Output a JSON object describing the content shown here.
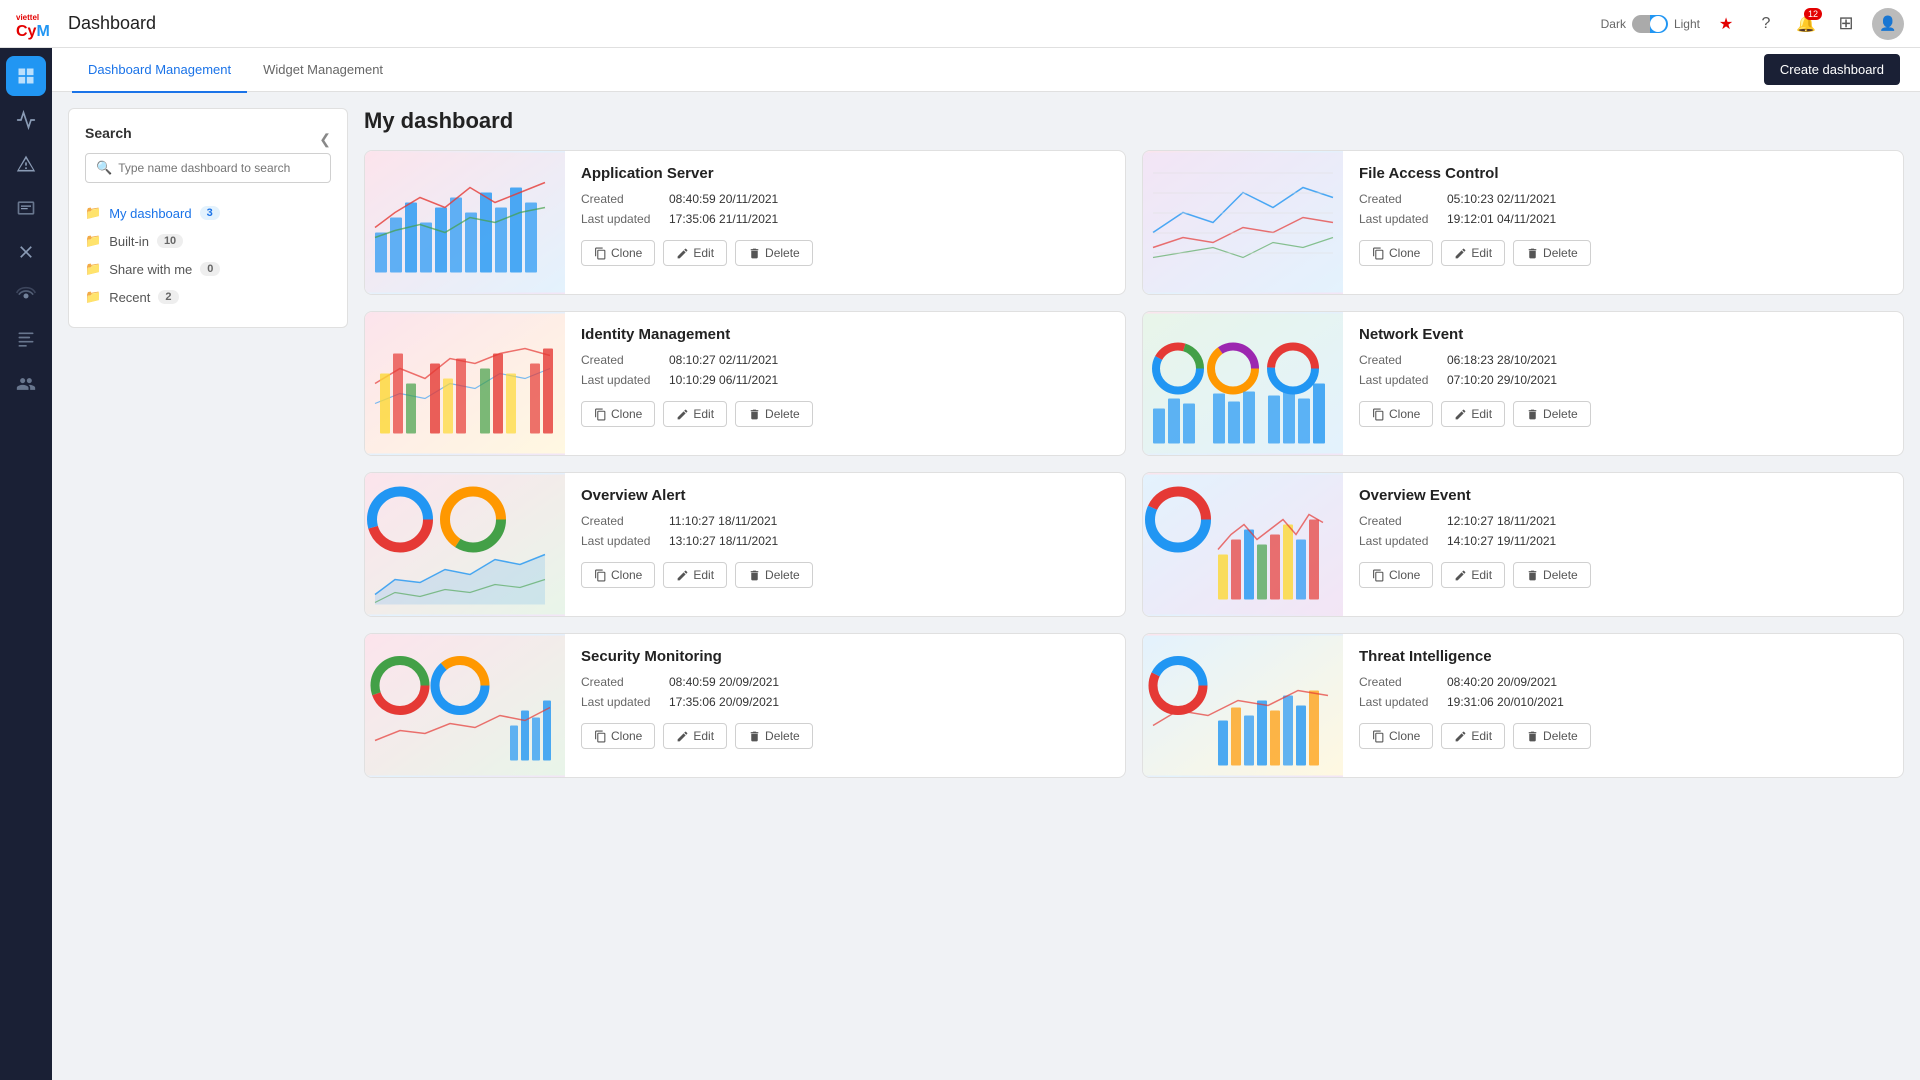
{
  "app": {
    "logo_brand": "viettel",
    "logo_product": "CyM",
    "title": "Dashboard"
  },
  "topnav": {
    "theme_dark": "Dark",
    "theme_light": "Light",
    "notification_count": "12",
    "create_btn": "Create dashboard"
  },
  "tabs": [
    {
      "id": "dashboard-management",
      "label": "Dashboard Management",
      "active": true
    },
    {
      "id": "widget-management",
      "label": "Widget Management",
      "active": false
    }
  ],
  "search": {
    "title": "Search",
    "placeholder": "Type name dashboard to search"
  },
  "nav_items": [
    {
      "id": "my-dashboard",
      "label": "My dashboard",
      "badge": "3",
      "badge_type": "blue",
      "active": true
    },
    {
      "id": "built-in",
      "label": "Built-in",
      "badge": "10",
      "badge_type": "gray",
      "active": false
    },
    {
      "id": "share-with-me",
      "label": "Share with me",
      "badge": "0",
      "badge_type": "gray",
      "active": false
    },
    {
      "id": "recent",
      "label": "Recent",
      "badge": "2",
      "badge_type": "gray",
      "active": false
    }
  ],
  "section_title": "My dashboard",
  "cards": [
    {
      "id": "application-server",
      "title": "Application Server",
      "created_label": "Created",
      "created_value": "08:40:59 20/11/2021",
      "updated_label": "Last updated",
      "updated_value": "17:35:06 21/11/2021",
      "clone_label": "Clone",
      "edit_label": "Edit",
      "delete_label": "Delete"
    },
    {
      "id": "file-access-control",
      "title": "File Access Control",
      "created_label": "Created",
      "created_value": "05:10:23 02/11/2021",
      "updated_label": "Last updated",
      "updated_value": "19:12:01 04/11/2021",
      "clone_label": "Clone",
      "edit_label": "Edit",
      "delete_label": "Delete"
    },
    {
      "id": "identity-management",
      "title": "Identity Management",
      "created_label": "Created",
      "created_value": "08:10:27 02/11/2021",
      "updated_label": "Last updated",
      "updated_value": "10:10:29 06/11/2021",
      "clone_label": "Clone",
      "edit_label": "Edit",
      "delete_label": "Delete"
    },
    {
      "id": "network-event",
      "title": "Network Event",
      "created_label": "Created",
      "created_value": "06:18:23 28/10/2021",
      "updated_label": "Last updated",
      "updated_value": "07:10:20 29/10/2021",
      "clone_label": "Clone",
      "edit_label": "Edit",
      "delete_label": "Delete"
    },
    {
      "id": "overview-alert",
      "title": "Overview Alert",
      "created_label": "Created",
      "created_value": "11:10:27 18/11/2021",
      "updated_label": "Last updated",
      "updated_value": "13:10:27 18/11/2021",
      "clone_label": "Clone",
      "edit_label": "Edit",
      "delete_label": "Delete"
    },
    {
      "id": "overview-event",
      "title": "Overview Event",
      "created_label": "Created",
      "created_value": "12:10:27 18/11/2021",
      "updated_label": "Last updated",
      "updated_value": "14:10:27 19/11/2021",
      "clone_label": "Clone",
      "edit_label": "Edit",
      "delete_label": "Delete"
    },
    {
      "id": "security-monitoring",
      "title": "Security Monitoring",
      "created_label": "Created",
      "created_value": "08:40:59 20/09/2021",
      "updated_label": "Last updated",
      "updated_value": "17:35:06 20/09/2021",
      "clone_label": "Clone",
      "edit_label": "Edit",
      "delete_label": "Delete"
    },
    {
      "id": "threat-intelligence",
      "title": "Threat Intelligence",
      "created_label": "Created",
      "created_value": "08:40:20 20/09/2021",
      "updated_label": "Last updated",
      "updated_value": "19:31:06 20/010/2021",
      "clone_label": "Clone",
      "edit_label": "Edit",
      "delete_label": "Delete"
    }
  ],
  "sidebar_icons": [
    "menu",
    "dashboard",
    "alert",
    "chart",
    "cross",
    "map",
    "bar-chart",
    "users"
  ],
  "colors": {
    "sidebar_bg": "#1a2035",
    "active_blue": "#2196f3",
    "brand_red": "#e30000"
  }
}
